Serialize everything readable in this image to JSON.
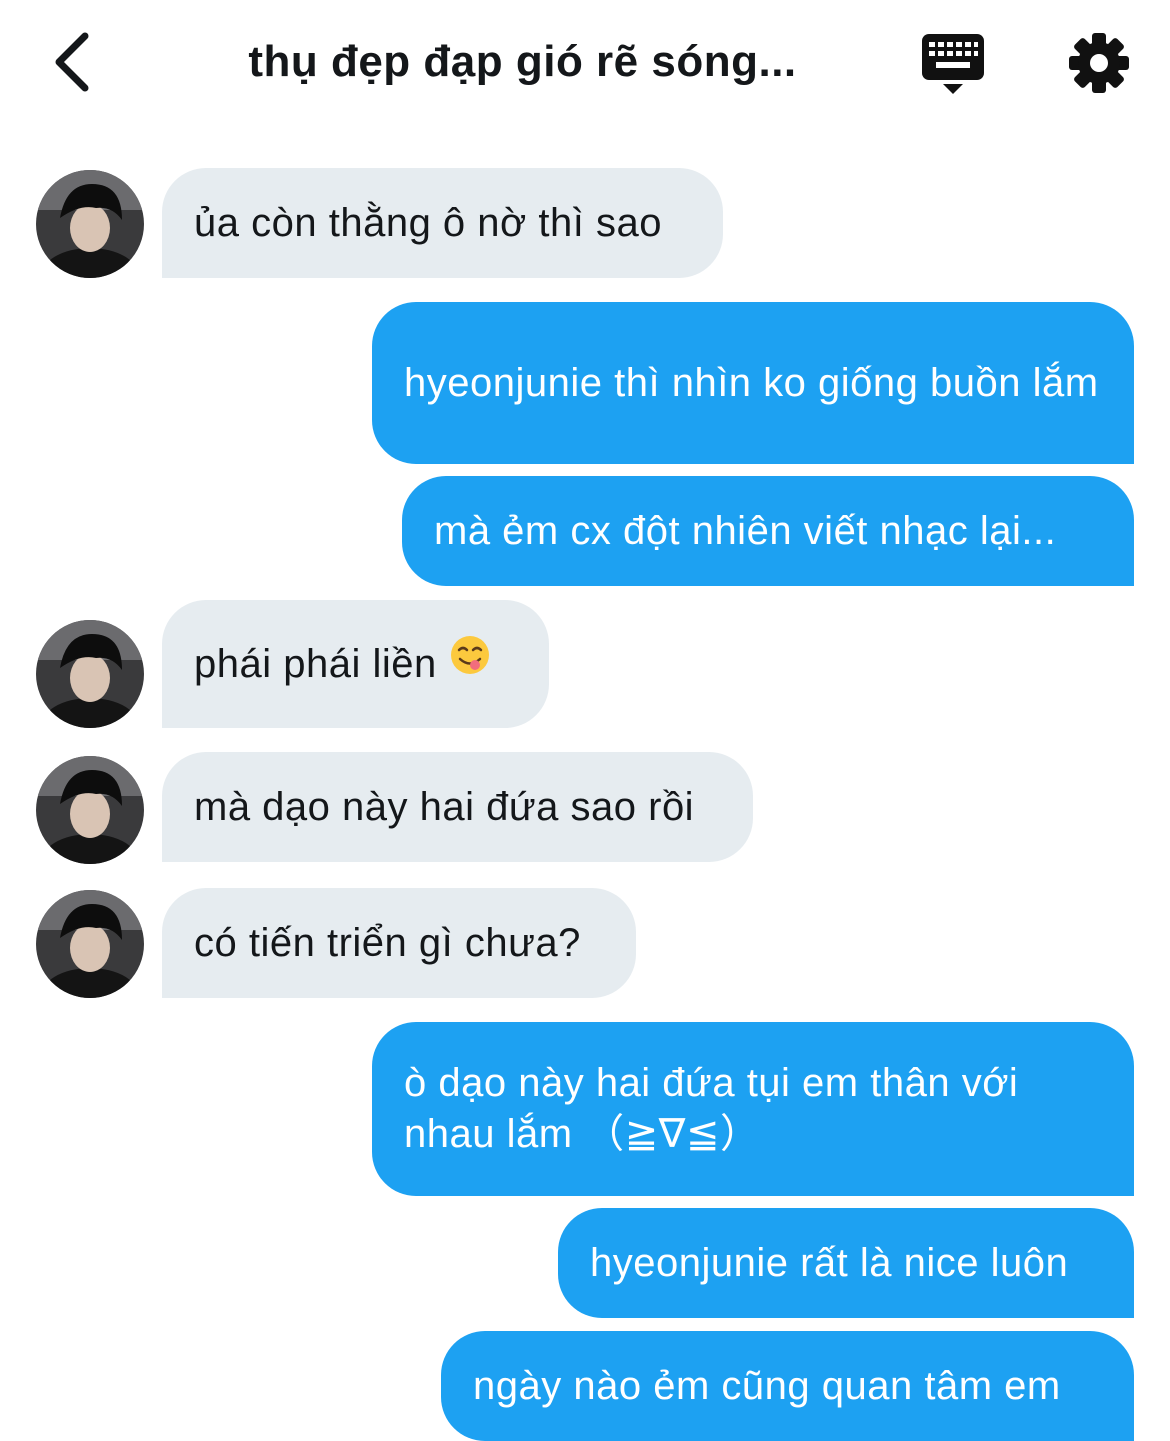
{
  "header": {
    "title": "thụ đẹp đạp gió rẽ sóng...",
    "back_icon": "chevron-left-icon",
    "keyboard_icon": "keyboard-icon",
    "settings_icon": "gear-icon"
  },
  "colors": {
    "outgoing_bubble": "#1da1f2",
    "incoming_bubble": "#e6ecf0"
  },
  "messages": [
    {
      "direction": "in",
      "text": "ủa còn thằng ô nờ thì sao"
    },
    {
      "direction": "out",
      "text": "hyeonjunie thì nhìn ko giống buồn lắm"
    },
    {
      "direction": "out",
      "text": "mà ẻm cx đột nhiên viết nhạc lại..."
    },
    {
      "direction": "in",
      "text": "phái phái liền",
      "emoji": "face-savoring-food-emoji"
    },
    {
      "direction": "in",
      "text": "mà dạo này hai đứa sao rồi"
    },
    {
      "direction": "in",
      "text": "có tiến triển gì chưa?"
    },
    {
      "direction": "out",
      "text": "ò dạo này hai đứa tụi em thân với nhau lắm （≧∇≦）"
    },
    {
      "direction": "out",
      "text": "hyeonjunie rất là nice luôn"
    },
    {
      "direction": "out",
      "text": "ngày nào ẻm cũng quan tâm em"
    }
  ]
}
